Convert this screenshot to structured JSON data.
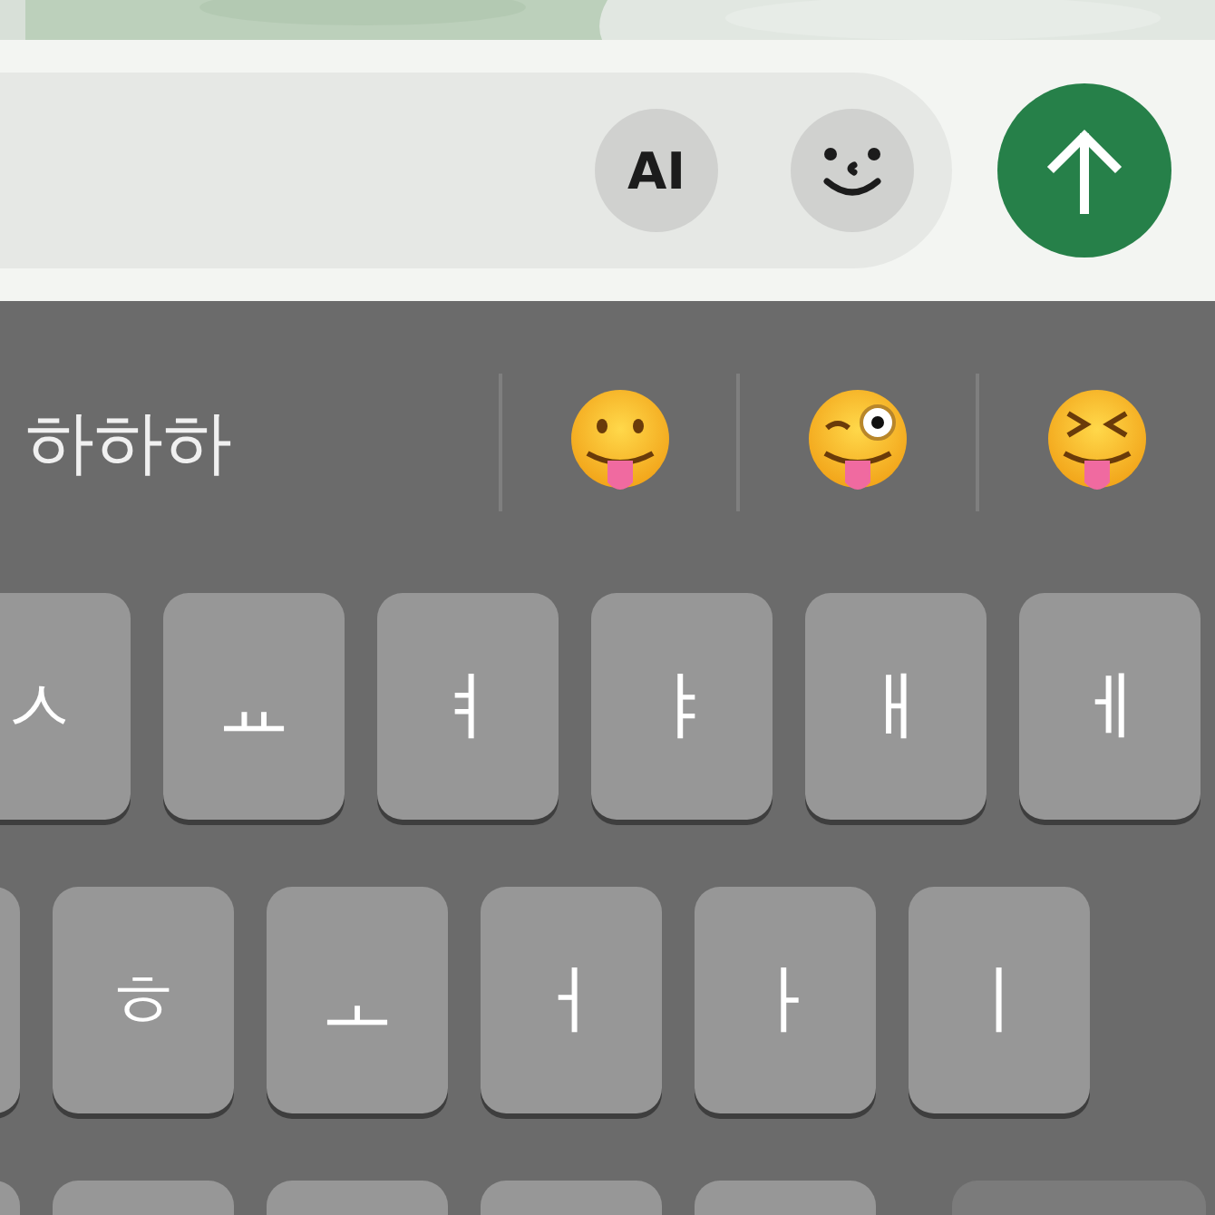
{
  "composer": {
    "ai_button": {
      "label": "AI"
    }
  },
  "suggestions": [
    {
      "kind": "text",
      "label": "하하하"
    },
    {
      "kind": "tongue"
    },
    {
      "kind": "wink"
    },
    {
      "kind": "squint"
    }
  ],
  "keyboard_rows": [
    {
      "keys": [
        {
          "kind": "letter",
          "label": "ㅅ"
        },
        {
          "kind": "letter",
          "label": "ㅛ"
        },
        {
          "kind": "letter",
          "label": "ㅕ"
        },
        {
          "kind": "letter",
          "label": "ㅑ"
        },
        {
          "kind": "letter",
          "label": "ㅐ"
        },
        {
          "kind": "letter",
          "label": "ㅔ"
        }
      ]
    },
    {
      "keys": [
        {
          "kind": "letter"
        },
        {
          "kind": "letter",
          "label": "ㅎ"
        },
        {
          "kind": "letter",
          "label": "ㅗ"
        },
        {
          "kind": "letter",
          "label": "ㅓ"
        },
        {
          "kind": "letter",
          "label": "ㅏ"
        },
        {
          "kind": "letter",
          "label": "ㅣ"
        }
      ]
    },
    {
      "keys": [
        {
          "kind": "letter"
        },
        {
          "kind": "letter"
        },
        {
          "kind": "letter"
        },
        {
          "kind": "letter"
        },
        {
          "kind": "letter"
        },
        {
          "kind": "function"
        }
      ]
    }
  ]
}
